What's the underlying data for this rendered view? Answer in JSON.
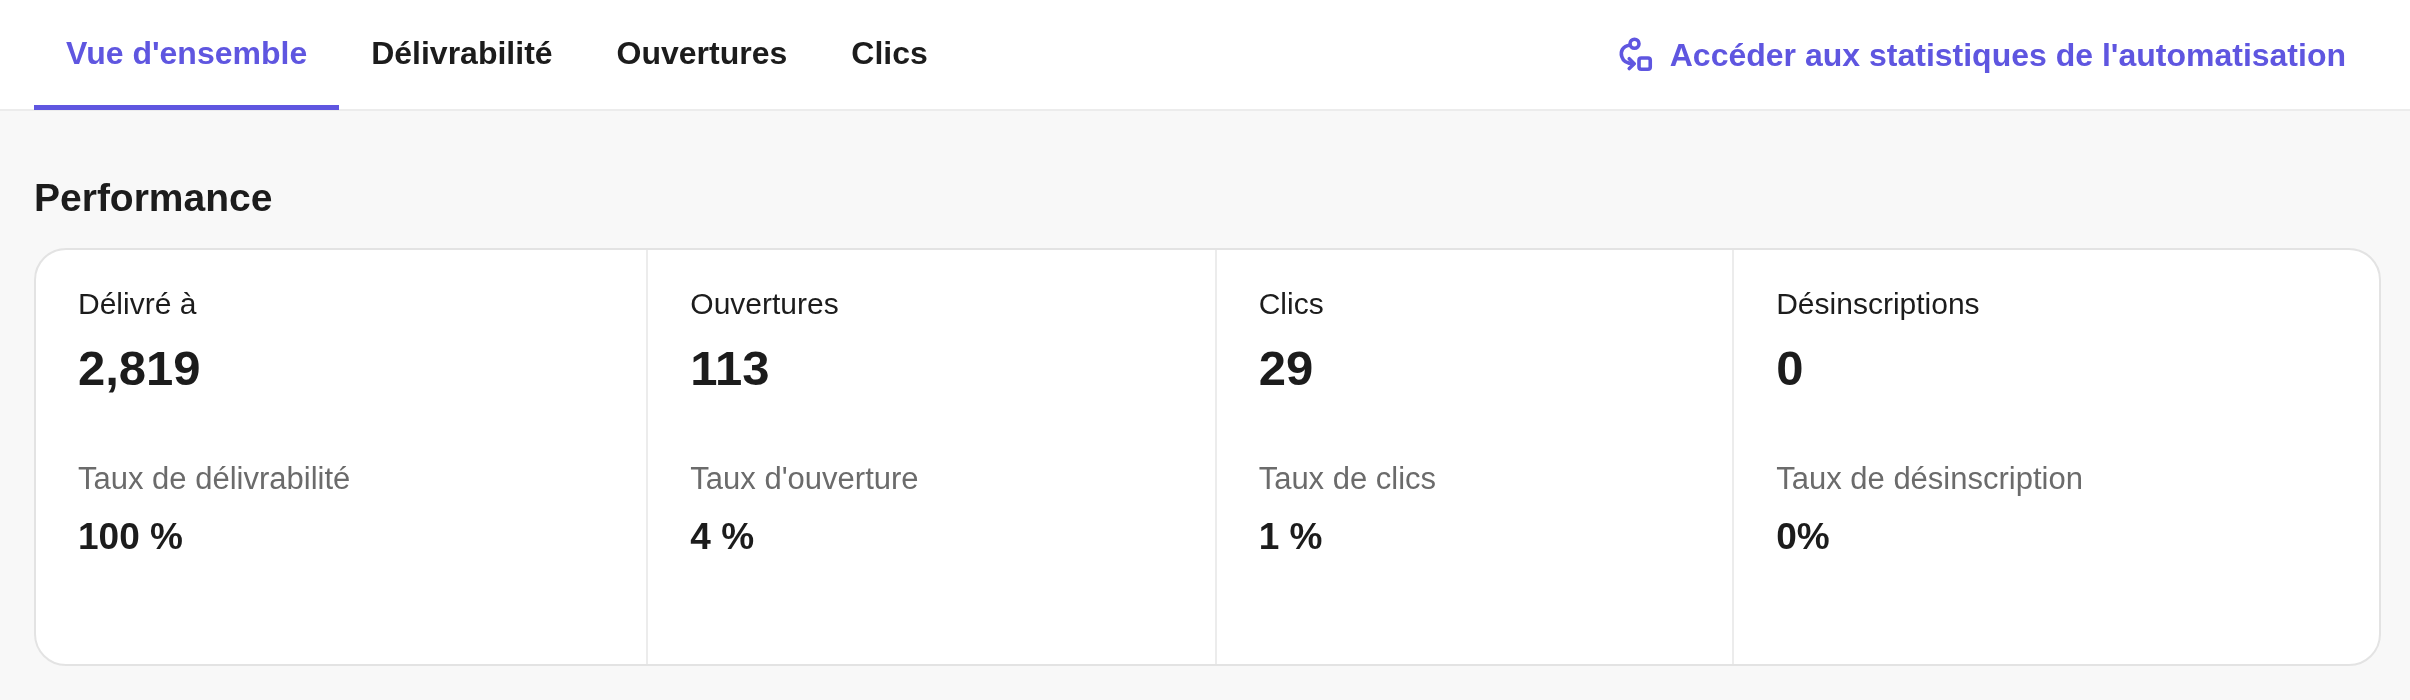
{
  "tabs": [
    {
      "label": "Vue d'ensemble",
      "selected": true
    },
    {
      "label": "Délivrabilité",
      "selected": false
    },
    {
      "label": "Ouvertures",
      "selected": false
    },
    {
      "label": "Clics",
      "selected": false
    }
  ],
  "automation_link": {
    "label": "Accéder aux statistiques de l'automatisation"
  },
  "section_title": "Performance",
  "metrics": [
    {
      "label": "Délivré à",
      "value": "2,819",
      "rate_label": "Taux de délivrabilité",
      "rate_value": "100 %"
    },
    {
      "label": "Ouvertures",
      "value": "113",
      "rate_label": "Taux d'ouverture",
      "rate_value": "4 %"
    },
    {
      "label": "Clics",
      "value": "29",
      "rate_label": "Taux de clics",
      "rate_value": "1 %"
    },
    {
      "label": "Désinscriptions",
      "value": "0",
      "rate_label": "Taux de désinscription",
      "rate_value": "0%"
    }
  ]
}
